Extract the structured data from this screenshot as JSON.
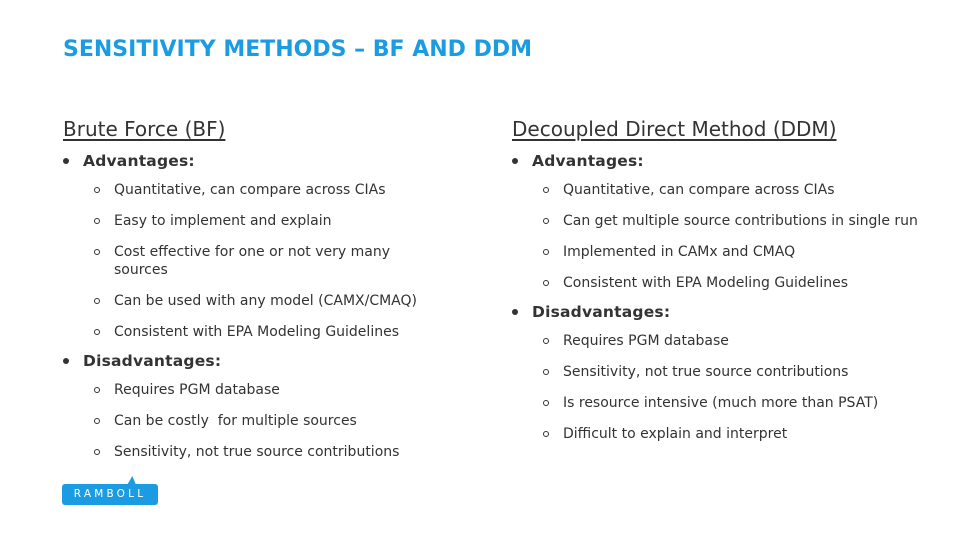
{
  "title": "SENSITIVITY METHODS – BF AND DDM",
  "accent_color": "#1b9ce2",
  "columns": [
    {
      "heading": "Brute Force (BF)",
      "sections": [
        {
          "label": "Advantages:",
          "items": [
            "Quantitative, can compare across CIAs",
            "Easy to implement and explain",
            "Cost effective for one or not very many sources",
            "Can be used with any model (CAMX/CMAQ)",
            "Consistent with EPA Modeling Guidelines"
          ]
        },
        {
          "label": "Disadvantages:",
          "items": [
            "Requires PGM database",
            "Can be costly  for multiple sources",
            "Sensitivity, not true source contributions"
          ]
        }
      ]
    },
    {
      "heading": "Decoupled Direct Method (DDM)",
      "sections": [
        {
          "label": "Advantages:",
          "items": [
            "Quantitative, can compare across CIAs",
            "Can get multiple source contributions in single run",
            "Implemented in CAMx and CMAQ",
            "Consistent with EPA Modeling Guidelines"
          ]
        },
        {
          "label": "Disadvantages:",
          "items": [
            "Requires PGM database",
            "Sensitivity, not true source contributions",
            "Is resource intensive (much more than PSAT)",
            "Difficult to explain and interpret"
          ]
        }
      ]
    }
  ],
  "logo": {
    "text": "RAMBOLL",
    "icon": "ramboll-logo-icon"
  }
}
